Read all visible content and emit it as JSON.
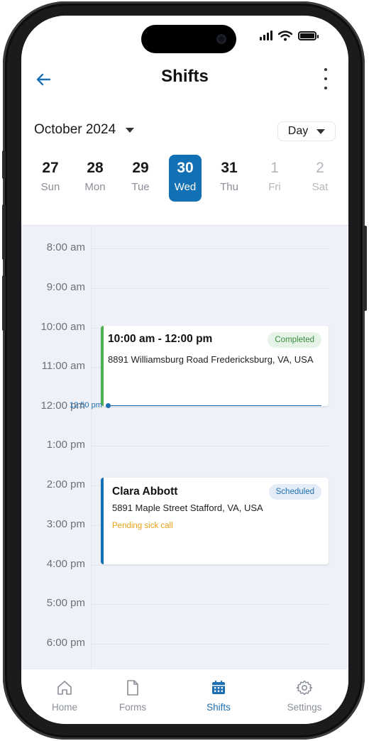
{
  "header": {
    "title": "Shifts"
  },
  "calendar": {
    "month_label": "October 2024",
    "view_label": "Day",
    "days": [
      {
        "num": "27",
        "dow": "Sun"
      },
      {
        "num": "28",
        "dow": "Mon"
      },
      {
        "num": "29",
        "dow": "Tue"
      },
      {
        "num": "30",
        "dow": "Wed"
      },
      {
        "num": "31",
        "dow": "Thu"
      },
      {
        "num": "1",
        "dow": "Fri"
      },
      {
        "num": "2",
        "dow": "Sat"
      }
    ],
    "selected_day": "30"
  },
  "timeline": {
    "hours": [
      "8:00 am",
      "9:00 am",
      "10:00 am",
      "11:00 am",
      "12:00 pm",
      "1:00 pm",
      "2:00 pm",
      "3:00 pm",
      "4:00 pm",
      "5:00 pm",
      "6:00 pm"
    ],
    "current_time": "12:50 pm"
  },
  "shifts": [
    {
      "heading": "10:00 am - 12:00 pm",
      "address": "8891 Williamsburg Road Fredericksburg, VA, USA",
      "status": "Completed",
      "accent": "#4caf50",
      "badge_bg": "#e6f4e7",
      "badge_fg": "#3a8a3e"
    },
    {
      "heading": "Clara Abbott",
      "address": "5891 Maple Street Stafford, VA, USA",
      "status": "Scheduled",
      "note": "Pending sick call",
      "accent": "#1270b5",
      "badge_bg": "#e3ecf7",
      "badge_fg": "#1e6fb0"
    }
  ],
  "tabbar": {
    "tabs": [
      {
        "label": "Home",
        "icon": "home-icon"
      },
      {
        "label": "Forms",
        "icon": "document-icon"
      },
      {
        "label": "Shifts",
        "icon": "calendar-icon"
      },
      {
        "label": "Settings",
        "icon": "gear-icon"
      }
    ],
    "active": "Shifts"
  },
  "colors": {
    "primary": "#1270b5",
    "timeline_bg": "#eef1f7",
    "pending": "#e8a317"
  }
}
